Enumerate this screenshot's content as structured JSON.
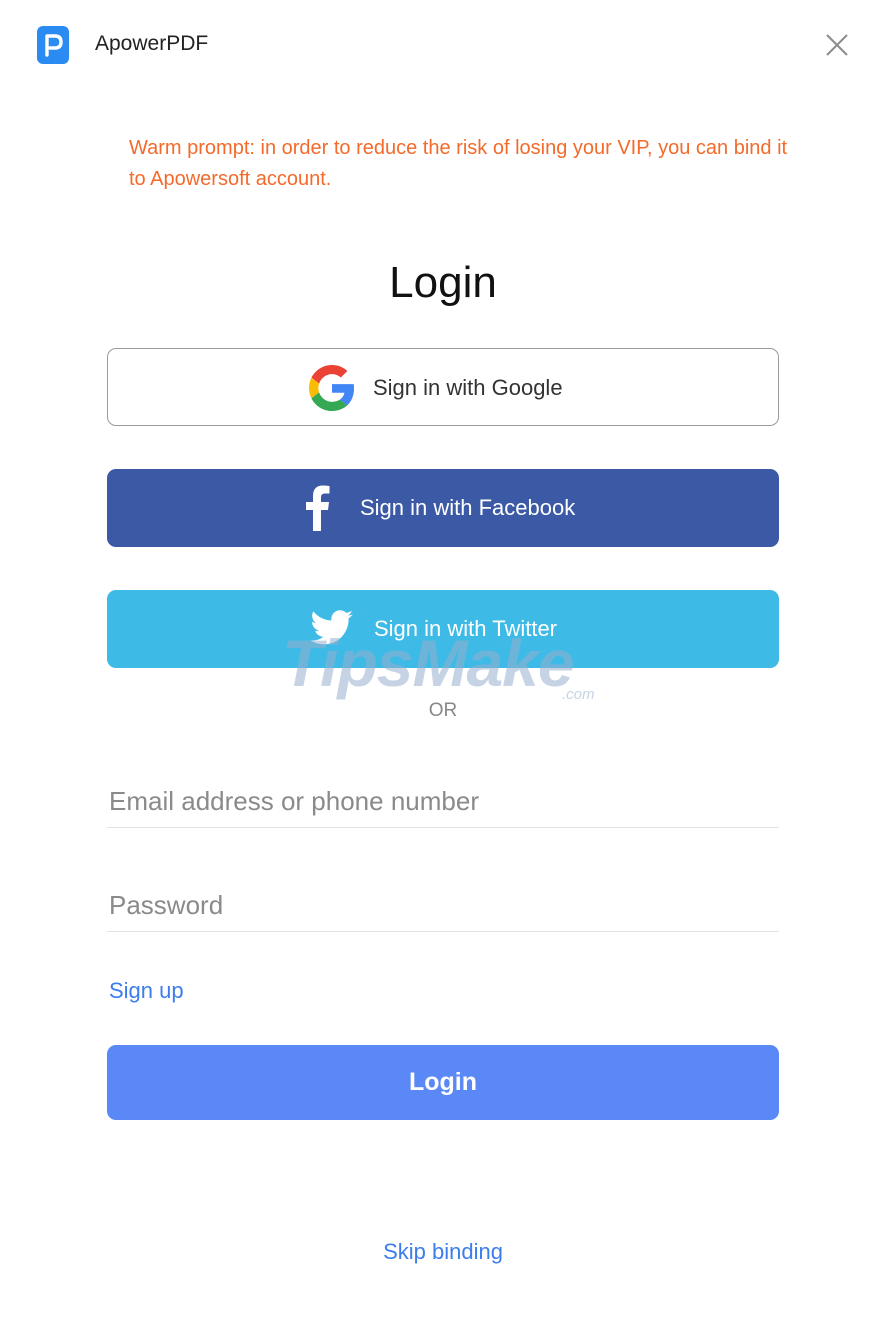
{
  "window": {
    "app_title": "ApowerPDF",
    "logo_letter": "P",
    "logo_icon": "apowerpdf-logo-icon",
    "close_icon": "close-icon"
  },
  "prompt": {
    "text": "Warm prompt: in order to reduce the risk of losing your VIP, you can bind it to Apowersoft account.",
    "color": "#f46a2a"
  },
  "login": {
    "heading": "Login",
    "social": [
      {
        "label": "Sign in with Google",
        "icon": "google-icon",
        "color": "#ffffff"
      },
      {
        "label": "Sign in with Facebook",
        "icon": "facebook-icon",
        "color": "#3b59a4"
      },
      {
        "label": "Sign in with Twitter",
        "icon": "twitter-icon",
        "color": "#3ebae6"
      }
    ],
    "separator": "OR",
    "email_placeholder": "Email address or phone number",
    "email_value": "",
    "password_placeholder": "Password",
    "password_value": "",
    "signup_label": "Sign up",
    "submit_label": "Login",
    "submit_color": "#5b88f7",
    "skip_label": "Skip binding"
  },
  "watermark": {
    "text": "TipsMake",
    "suffix": ".com"
  }
}
